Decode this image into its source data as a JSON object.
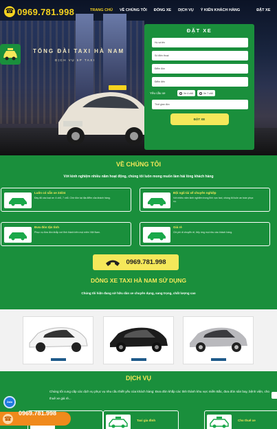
{
  "header": {
    "phone": "0969.781.998",
    "nav": [
      "TRANG CHỦ",
      "VỀ CHÚNG TÔI",
      "ĐÓNG XE",
      "DỊCH VỤ",
      "Ý KIẾN KHÁCH HÀNG",
      "ĐẶT XE"
    ]
  },
  "hero": {
    "title": "TỔNG ĐÀI TAXI HÀ NAM",
    "subtitle": "DỊCH VỤ 5P TAXI"
  },
  "booking": {
    "title": "ĐẶT XE",
    "fields": {
      "name": "Họ và tên",
      "phone": "Số điện thoại",
      "from": "Điểm đón",
      "to": "Điểm đến",
      "time": "Thời gian đón"
    },
    "request_label": "Yêu cầu xe",
    "options": [
      "Xe 4 chỗ",
      "Xe 7 chỗ"
    ],
    "submit": "ĐẶT XE"
  },
  "about": {
    "title": "VỀ CHÚNG TÔI",
    "desc": "Với kinh nghiệm nhiều năm hoạt động, chúng tôi luôn mong muốn làm hài lòng khách hàng",
    "features": [
      {
        "title": "Luôn có sẵn xe 24/24",
        "desc": "Đầy đủ các loại xe: 4 chỗ, 7 chỗ. Chờ đón tại địa điểm của khách hàng."
      },
      {
        "title": "Đội ngũ tài xế chuyên nghiệp",
        "desc": "Với nhiều năm kinh nghiệm trong lĩnh vực taxi, chúng tôi luôn an toàn phục vụ."
      },
      {
        "title": "Đưa đón tận tình",
        "desc": "Phục vụ đưa đón khắp nơi tỉnh thành trên mọi miền Việt Nam."
      },
      {
        "title": "Giá rẻ",
        "desc": "Chi phí di chuyển rẻ, tiếp ứng mọi nhu cầu khách hàng."
      }
    ]
  },
  "call": {
    "phone": "0969.781.998"
  },
  "fleet": {
    "title": "DÒNG XE TAXI HÀ NAM SỬ DỤNG",
    "desc": "Chúng tôi hiện đang sở hữu dàn xe chuyên dụng, sang trọng, chất lượng cao",
    "cars": [
      {
        "color": "#ffffff"
      },
      {
        "color": "#1c1c1c"
      },
      {
        "color": "#b9b9bd"
      }
    ]
  },
  "services": {
    "title": "DỊCH VỤ",
    "desc": "Chúng tôi cung cấp các dịch vụ phục vụ nhu cầu thiết yếu của khách hàng: Đưa đón khắp các tỉnh thành khu vực miền Bắc, đưa đón sân bay, bệnh viện, cho thuê xe giá rẻ...",
    "items": [
      {
        "title": ""
      },
      {
        "title": "Taxi gia đình"
      },
      {
        "title": "Cho thuê xe"
      }
    ]
  },
  "floating": {
    "zalo": "Zalo",
    "phone": "0969.781.998"
  }
}
